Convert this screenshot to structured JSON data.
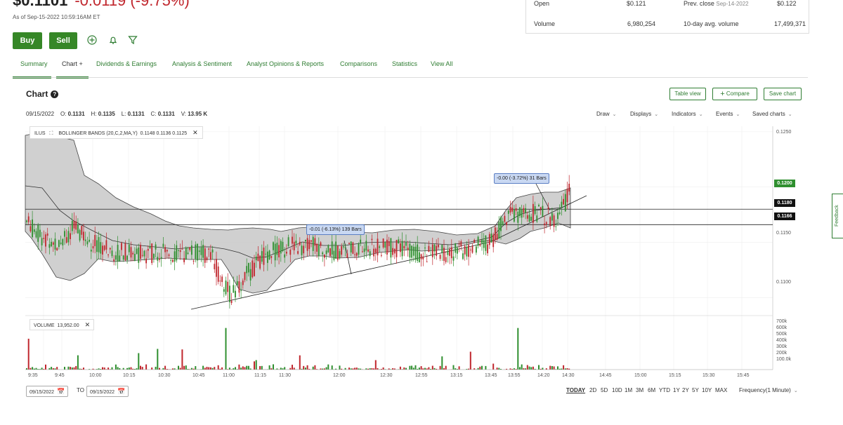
{
  "quote": {
    "price": "$0.1101",
    "change": "-0.0119 (-9.75%)",
    "as_of": "As of Sep-15-2022 10:59:16AM ET"
  },
  "actions": {
    "buy": "Buy",
    "sell": "Sell"
  },
  "stats": {
    "open_label": "Open",
    "open_value": "$0.121",
    "prev_close_label": "Prev. close",
    "prev_close_date": "Sep-14-2022",
    "prev_close_value": "$0.122",
    "volume_label": "Volume",
    "volume_value": "6,980,254",
    "avg_volume_label": "10-day avg. volume",
    "avg_volume_value": "17,499,371"
  },
  "tabs": [
    {
      "label": "Summary"
    },
    {
      "label": "Chart +"
    },
    {
      "label": "Dividends & Earnings"
    },
    {
      "label": "Analysis & Sentiment"
    },
    {
      "label": "Analyst Opinions & Reports"
    },
    {
      "label": "Comparisons"
    },
    {
      "label": "Statistics"
    },
    {
      "label": "View All"
    }
  ],
  "active_tab": "Chart +",
  "chart_header": {
    "title": "Chart",
    "help": "?",
    "table_view": "Table view",
    "compare": "Compare",
    "save_chart": "Save chart"
  },
  "ohlc": {
    "date": "09/15/2022",
    "o_label": "O:",
    "o": "0.1131",
    "h_label": "H:",
    "h": "0.1135",
    "l_label": "L:",
    "l": "0.1131",
    "c_label": "C:",
    "c": "0.1131",
    "v_label": "V:",
    "v": "13.95 K"
  },
  "toolbar": [
    "Draw",
    "Displays",
    "Indicators",
    "Events",
    "Saved charts"
  ],
  "indicator": {
    "symbol": "ILUS",
    "label": "BOLLINGER BANDS (20,C,2,MA,Y)",
    "values": "0.1148  0.1136  0.1125"
  },
  "volume_panel": {
    "label": "VOLUME",
    "value": "13,952.00"
  },
  "annotations": [
    {
      "text": "-0.01 (-6.13%) 139 Bars"
    },
    {
      "text": "-0.00 (-3.72%) 31 Bars"
    }
  ],
  "chart_data": {
    "type": "candlestick",
    "y_ticks": [
      "0.1250",
      "0.1150",
      "0.1100"
    ],
    "ylim": [
      0.1085,
      0.1255
    ],
    "flags": [
      {
        "label": "0.1200",
        "color": "#2f8f2f"
      },
      {
        "label": "0.1180",
        "color": "#111111"
      },
      {
        "label": "0.1166",
        "color": "#111111"
      }
    ],
    "horizontal_lines": [
      0.118,
      0.1166
    ],
    "volume_ticks": [
      "700k",
      "600k",
      "500k",
      "400k",
      "300k",
      "200k",
      "100.0k"
    ],
    "volume_max": 700000,
    "x_ticks": [
      "9:35",
      "9:45",
      "10:00",
      "10:15",
      "10:30",
      "10:45",
      "11:00",
      "11:15",
      "11:30",
      "12:00",
      "12:30",
      "12:55",
      "13:15",
      "13:45",
      "13:55",
      "14:20",
      "14:30",
      "14:45",
      "15:00",
      "15:15",
      "15:30",
      "15:45"
    ],
    "up_color": "#2f8f2f",
    "down_color": "#c0262d",
    "band_color": "#c8c8c8"
  },
  "date_range": {
    "from": "09/15/2022",
    "to_label": "TO",
    "to": "09/15/2022"
  },
  "ranges": [
    "TODAY",
    "2D",
    "5D",
    "10D",
    "1M",
    "3M",
    "6M",
    "YTD",
    "1Y",
    "2Y",
    "5Y",
    "10Y",
    "MAX"
  ],
  "frequency": "Frequency(1 Minute)",
  "feedback": "Feedback"
}
